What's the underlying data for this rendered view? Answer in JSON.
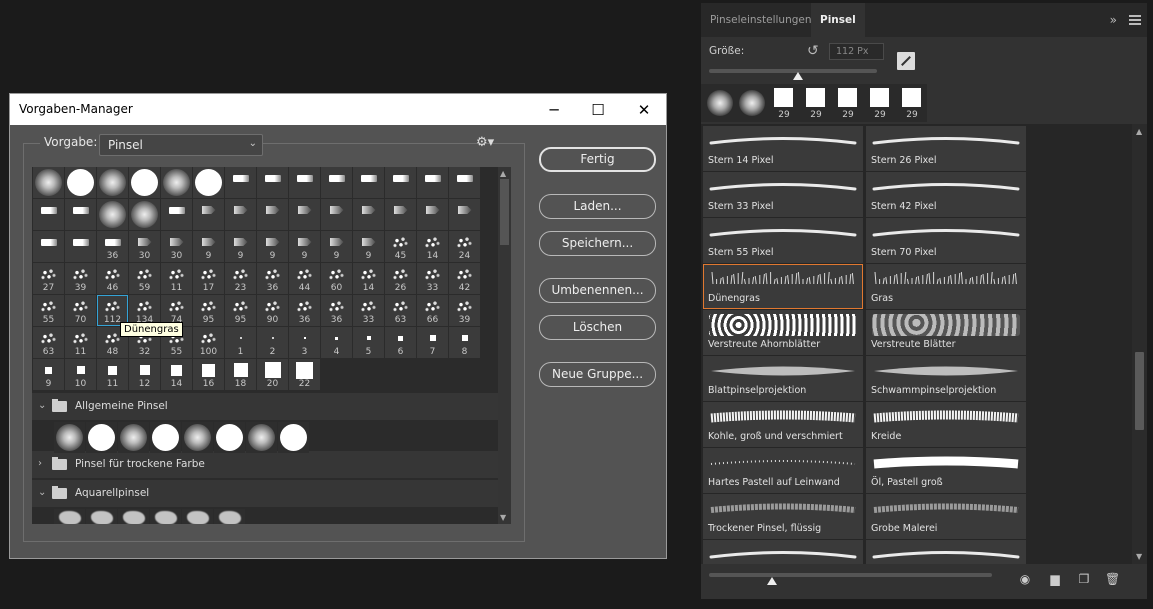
{
  "dialog": {
    "title": "Vorgaben-Manager",
    "minimize": "─",
    "maximize": "☐",
    "close": "✕",
    "preset_label": "Vorgabe:",
    "preset_value": "Pinsel",
    "gear": "⚙▾",
    "tooltip": "Dünengras",
    "buttons": {
      "done": "Fertig",
      "load": "Laden...",
      "save": "Speichern...",
      "rename": "Umbenennen...",
      "delete": "Löschen",
      "new_group": "Neue Gruppe..."
    },
    "grid_rows": [
      [
        [
          "soft",
          ""
        ],
        [
          "hard",
          ""
        ],
        [
          "soft",
          ""
        ],
        [
          "hard",
          ""
        ],
        [
          "soft",
          ""
        ],
        [
          "hard",
          ""
        ],
        [
          "tip",
          ""
        ],
        [
          "tip",
          ""
        ],
        [
          "tip",
          ""
        ],
        [
          "tip",
          ""
        ],
        [
          "tip",
          ""
        ],
        [
          "tip",
          ""
        ],
        [
          "tip",
          ""
        ],
        [
          "tip",
          ""
        ]
      ],
      [
        [
          "tip",
          ""
        ],
        [
          "tip",
          ""
        ],
        [
          "soft",
          ""
        ],
        [
          "soft",
          ""
        ],
        [
          "tip",
          ""
        ],
        [
          "tip2",
          ""
        ],
        [
          "tip2",
          ""
        ],
        [
          "tip2",
          ""
        ],
        [
          "tip2",
          ""
        ],
        [
          "tip2",
          ""
        ],
        [
          "tip2",
          ""
        ],
        [
          "tip2",
          ""
        ],
        [
          "tip2",
          ""
        ],
        [
          "tip2",
          ""
        ]
      ],
      [
        [
          "tip",
          ""
        ],
        [
          "tip",
          ""
        ],
        [
          "tip",
          "36"
        ],
        [
          "tip2",
          "30"
        ],
        [
          "tip2",
          "30"
        ],
        [
          "tip2",
          "9"
        ],
        [
          "tip2",
          "9"
        ],
        [
          "tip2",
          "9"
        ],
        [
          "tip2",
          "9"
        ],
        [
          "tip2",
          "9"
        ],
        [
          "tip2",
          "9"
        ],
        [
          "spl",
          "45"
        ],
        [
          "spl",
          "14"
        ],
        [
          "spl",
          "24"
        ]
      ],
      [
        [
          "spl",
          "27"
        ],
        [
          "spl",
          "39"
        ],
        [
          "spl",
          "46"
        ],
        [
          "spl",
          "59"
        ],
        [
          "spl",
          "11"
        ],
        [
          "spl",
          "17"
        ],
        [
          "spl",
          "23"
        ],
        [
          "spl",
          "36"
        ],
        [
          "spl",
          "44"
        ],
        [
          "spl",
          "60"
        ],
        [
          "spl",
          "14"
        ],
        [
          "spl",
          "26"
        ],
        [
          "spl",
          "33"
        ],
        [
          "spl",
          "42"
        ]
      ],
      [
        [
          "spl",
          "55"
        ],
        [
          "spl",
          "70"
        ],
        [
          "spl",
          "112"
        ],
        [
          "spl",
          "134"
        ],
        [
          "spl",
          "74"
        ],
        [
          "spl",
          "95"
        ],
        [
          "spl",
          "95"
        ],
        [
          "spl",
          "90"
        ],
        [
          "spl",
          "36"
        ],
        [
          "spl",
          "36"
        ],
        [
          "spl",
          "33"
        ],
        [
          "spl",
          "63"
        ],
        [
          "spl",
          "66"
        ],
        [
          "spl",
          "39"
        ]
      ],
      [
        [
          "spl",
          "63"
        ],
        [
          "spl",
          "11"
        ],
        [
          "spl",
          "48"
        ],
        [
          "spl",
          "32"
        ],
        [
          "spl",
          "55"
        ],
        [
          "spl",
          "100"
        ],
        [
          "dot",
          "1"
        ],
        [
          "dot",
          "2"
        ],
        [
          "sq",
          "3"
        ],
        [
          "sq",
          "4"
        ],
        [
          "sq",
          "5"
        ],
        [
          "sq",
          "6"
        ],
        [
          "sq",
          "7"
        ],
        [
          "sq",
          "8"
        ]
      ],
      [
        [
          "sq",
          "9"
        ],
        [
          "sq",
          "10"
        ],
        [
          "sq",
          "11"
        ],
        [
          "sq",
          "12"
        ],
        [
          "sq",
          "14"
        ],
        [
          "sq",
          "16"
        ],
        [
          "sq",
          "18"
        ],
        [
          "sq",
          "20"
        ],
        [
          "sq",
          "22"
        ]
      ]
    ],
    "groups": [
      {
        "arrow": "⌄",
        "label": "Allgemeine Pinsel"
      },
      {
        "arrow": "›",
        "label": "Pinsel für trockene Farbe"
      },
      {
        "arrow": "⌄",
        "label": "Aquarellpinsel"
      }
    ]
  },
  "panel": {
    "tabs": [
      "Pinseleinstellungen",
      "Pinsel"
    ],
    "collapse": "»",
    "size_label": "Größe:",
    "reset": "↺",
    "size_value": "112 Px",
    "recent_numbers": [
      "",
      "",
      "29",
      "29",
      "29",
      "29",
      "29"
    ],
    "brushes": [
      "Stern 14 Pixel",
      "Stern 26 Pixel",
      "Stern 33 Pixel",
      "Stern 42 Pixel",
      "Stern 55 Pixel",
      "Stern 70 Pixel",
      "Dünengras",
      "Gras",
      "Verstreute Ahornblätter",
      "Verstreute Blätter",
      "Blattpinselprojektion",
      "Schwammpinselprojektion",
      "Kohle, groß und verschmiert",
      "Kreide",
      "Hartes Pastell auf Leinwand",
      "Öl, Pastell groß",
      "Trockener Pinsel, flüssig",
      "Grobe Malerei",
      "",
      ""
    ],
    "footer_icons": [
      "eye-icon",
      "folder-icon",
      "new-icon",
      "trash-icon"
    ],
    "colors": {
      "selected_outline": "#e07830",
      "grid_selected": "#34a3d6"
    }
  }
}
